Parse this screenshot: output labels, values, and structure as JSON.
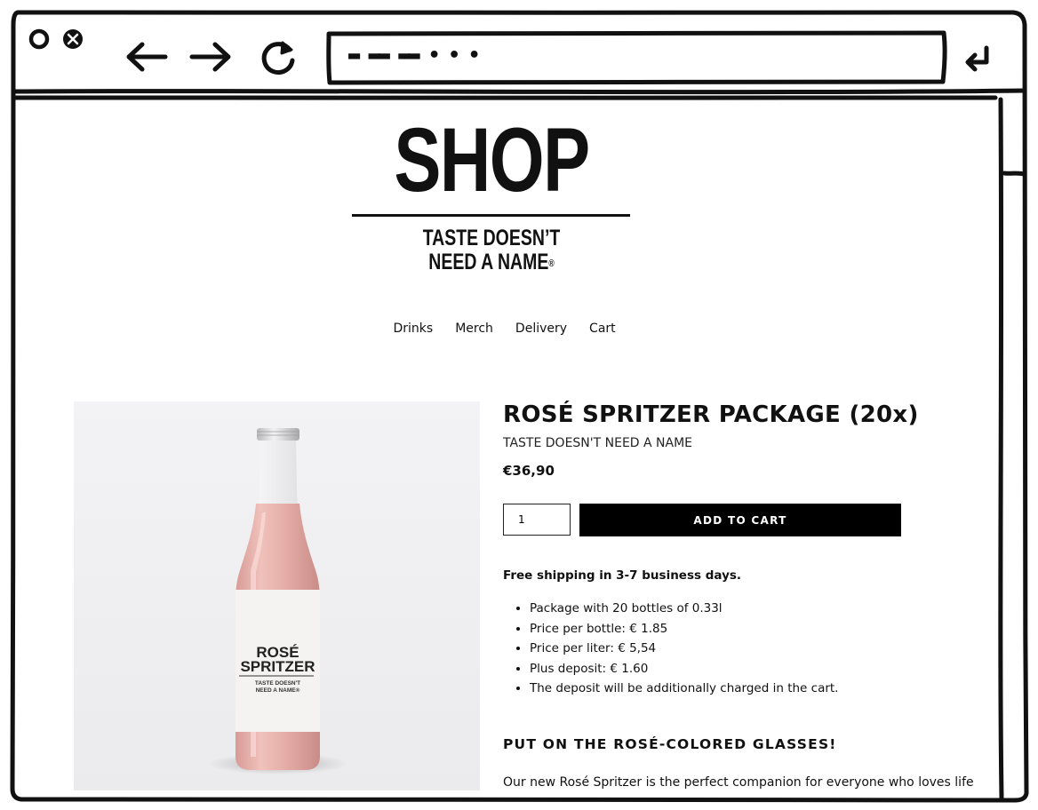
{
  "browser": {
    "url_text": "▬ ▬▬ ▬▬ • • •"
  },
  "header": {
    "logo": "SHOP",
    "tagline_line1": "TASTE DOESN’T",
    "tagline_line2": "NEED A NAME",
    "tagline_mark": "®"
  },
  "nav": {
    "items": [
      {
        "label": "Drinks"
      },
      {
        "label": "Merch"
      },
      {
        "label": "Delivery"
      },
      {
        "label": "Cart"
      }
    ]
  },
  "product": {
    "title": "ROSÉ SPRITZER PACKAGE (20x)",
    "subtitle": "TASTE DOESN'T NEED A NAME",
    "price": "€36,90",
    "quantity": "1",
    "add_to_cart_label": "ADD TO CART",
    "shipping": "Free shipping in 3-7 business days.",
    "details": [
      "Package with 20 bottles of 0.33l",
      "Price per bottle: € 1.85",
      "Price per liter: € 5,54",
      "Plus deposit: € 1.60",
      "The deposit will be additionally charged in the cart."
    ],
    "section_heading": "PUT ON THE ROSÉ-COLORED GLASSES!",
    "description": "Our new Rosé Spritzer is the perfect companion for everyone who loves life",
    "label": {
      "line1": "ROSÉ",
      "line2": "SPRITZER",
      "line3": "TASTE DOESN'T",
      "line4": "NEED A NAME®"
    }
  },
  "colors": {
    "ink": "#111111",
    "button": "#000000",
    "image_bg": "#f0f0f2",
    "rose": "#e8b3ad"
  }
}
